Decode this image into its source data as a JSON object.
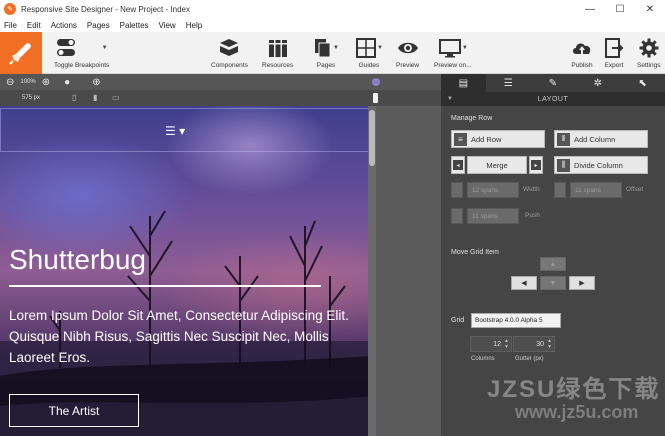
{
  "window": {
    "title": "Responsive Site Designer - New Project - Index",
    "controls": [
      "—",
      "☐",
      "✕"
    ]
  },
  "menu": [
    "File",
    "Edit",
    "Actions",
    "Pages",
    "Palettes",
    "View",
    "Help"
  ],
  "toolbar": {
    "toggle_breakpoints": "Toggle Breakpoints",
    "components": "Components",
    "resources": "Resources",
    "pages": "Pages",
    "guides": "Guides",
    "preview": "Preview",
    "preview_on": "Preview on...",
    "publish": "Publish",
    "export": "Export",
    "settings": "Settings"
  },
  "zoom": {
    "level": "100%"
  },
  "canvas_width": "575 px",
  "preview": {
    "title": "Shutterbug",
    "body": "Lorem Ipsum Dolor Sit Amet, Consectetur Adipiscing Elit. Quisque Nibh Risus, Sagittis Nec Suscipit Nec, Mollis Laoreet Eros.",
    "button": "The Artist"
  },
  "panel": {
    "header": "LAYOUT",
    "manage_row": {
      "title": "Manage Row",
      "add_row": "Add Row",
      "add_column": "Add Column",
      "merge": "Merge",
      "divide_column": "Divide Column",
      "width_value": "12 spans",
      "width_label": "Width",
      "offset_value": "11 spans",
      "offset_label": "Offset",
      "push_value": "11 spans",
      "push_label": "Push"
    },
    "move_grid": {
      "title": "Move Grid Item"
    },
    "grid": {
      "label": "Grid",
      "framework": "Bootstrap 4.0.0 Alpha 5",
      "columns_value": "12",
      "columns_label": "Columns",
      "gutter_value": "30",
      "gutter_label": "Gutter (px)"
    }
  },
  "watermark": {
    "line1": "JZSU绿色下载",
    "line2": "www.jz5u.com"
  }
}
